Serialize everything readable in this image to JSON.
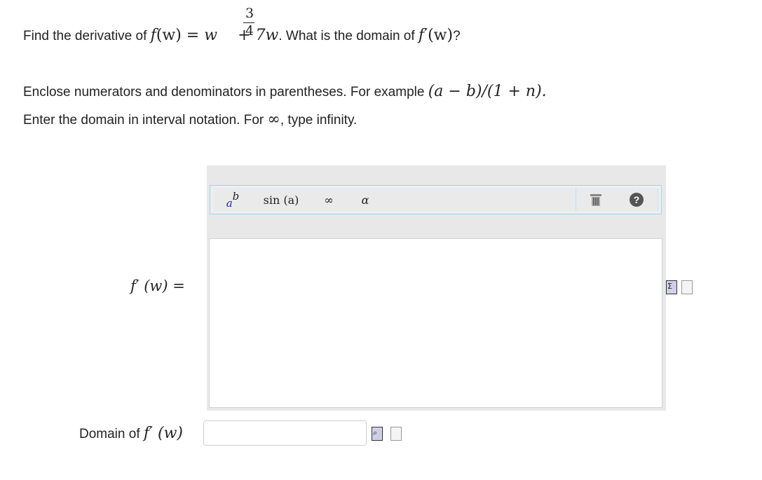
{
  "question": {
    "prefix": "Find the derivative of ",
    "func": "f",
    "arg": "(w)",
    "eq": " = ",
    "base": "w",
    "exp_num": "3",
    "exp_den": "4",
    "rest": " + 7w",
    "mid": ". What is the domain of ",
    "fprime": "f′",
    "arg2": "(w)",
    "end": "?"
  },
  "instructions": {
    "line1_text": "Enclose numerators and denominators in parentheses. For example ",
    "line1_example": "(a − b)/(1 + n).",
    "line2_pre": "Enter the domain in interval notation. For ",
    "line2_inf": "∞",
    "line2_post": ", type infinity."
  },
  "toolbar": {
    "pow_base": "a",
    "pow_exp": "b",
    "sin": "sin (a)",
    "infinity": "∞",
    "alpha": "α",
    "help": "?"
  },
  "answer": {
    "label": "f′ (w) ="
  },
  "domain": {
    "label_text": "Domain of ",
    "label_math": "f′ (w)",
    "value": ""
  },
  "colors": {
    "toolbar_border": "#9fd6ee",
    "panel_bg": "#e8e8e8",
    "pow_exp_color": "#2222aa"
  }
}
